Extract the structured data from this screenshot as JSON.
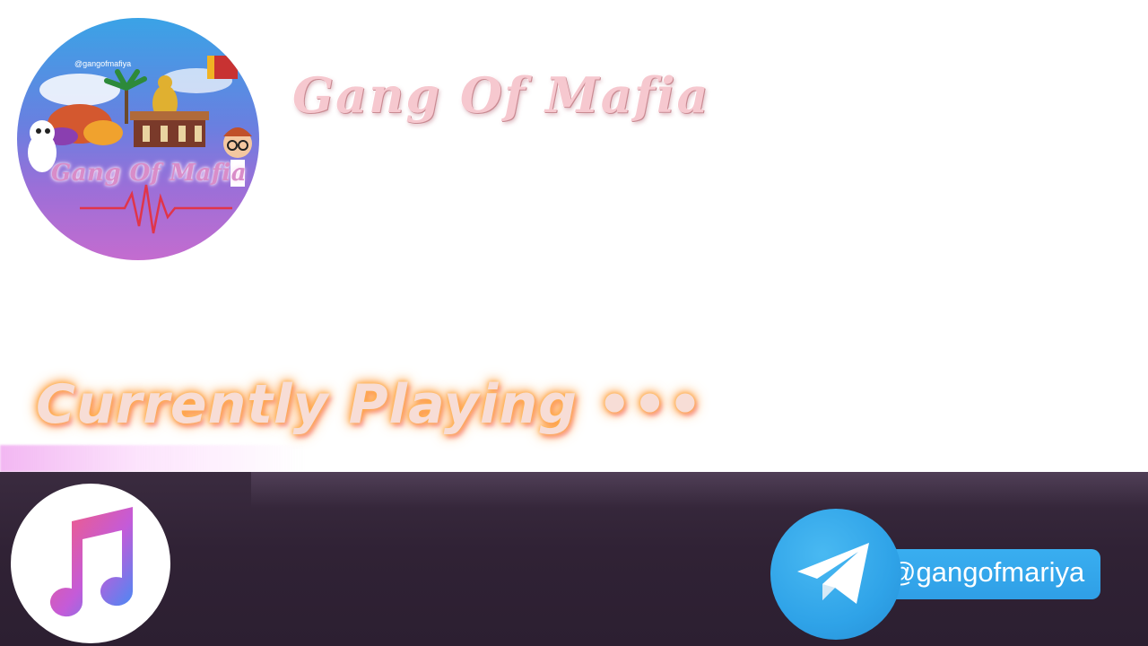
{
  "header": {
    "title": "Gang Of Mafia"
  },
  "logo": {
    "handle": "@gangofmafiya",
    "text": "Gang Of Mafia",
    "icon": "channel-logo"
  },
  "status": {
    "label": "Currently Playing •••"
  },
  "footer": {
    "music_icon": "apple-music-icon",
    "telegram_icon": "telegram-plane-icon",
    "telegram_handle": "@gangofmariya"
  },
  "colors": {
    "bar_background": "#302235",
    "telegram_blue": "#2fa3e8",
    "glow_orange": "#ff9a3a",
    "title_pink": "#f6c8cf"
  }
}
